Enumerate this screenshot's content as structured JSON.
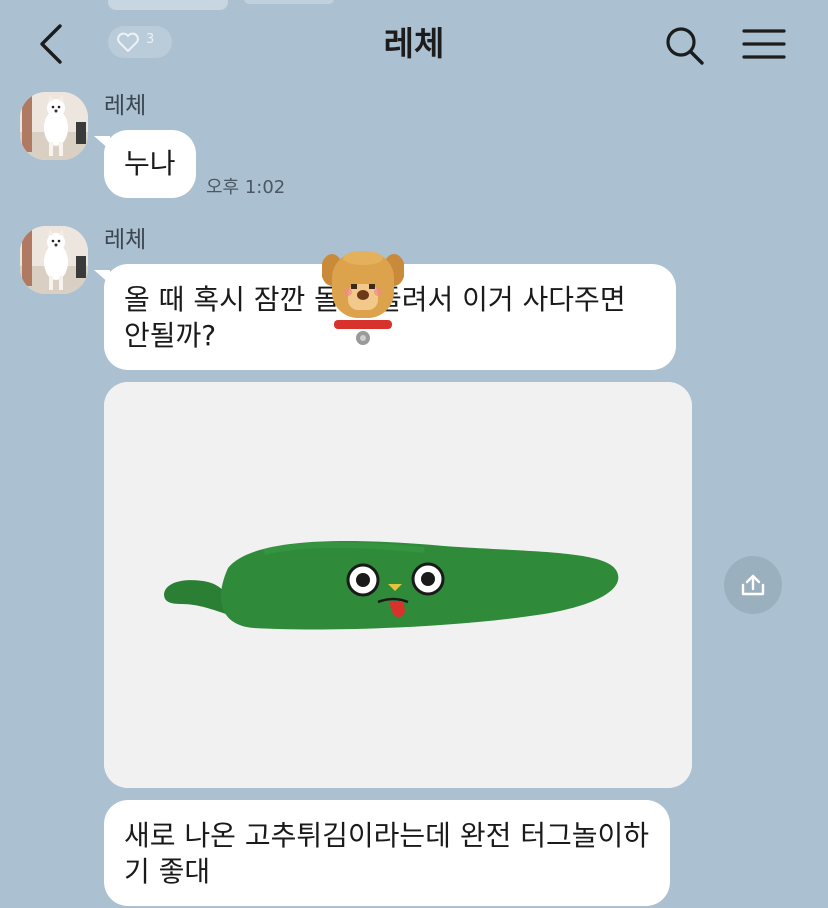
{
  "header": {
    "title": "레체",
    "like_count": "3",
    "back_icon": "chevron-left-icon",
    "search_icon": "search-icon",
    "menu_icon": "hamburger-menu-icon"
  },
  "messages": [
    {
      "sender": "레체",
      "text": "누나",
      "time": "오후 1:02"
    },
    {
      "sender": "레체",
      "text_line1": "올 때 혹시 잠깐 몰",
      "text_line1b": "들려서 이거 사다주면",
      "text_line2": "안될까?"
    },
    {
      "type": "photo",
      "subject": "green chili pepper plush toy",
      "share_icon": "share-icon"
    },
    {
      "text_line1": "새로 나온 고추튀김이라는데 완전 터그놀이하",
      "text_line2": "기 좋대"
    }
  ],
  "colors": {
    "background": "#abc1d1",
    "bubble": "#ffffff",
    "plush_green": "#2f8a3a"
  }
}
